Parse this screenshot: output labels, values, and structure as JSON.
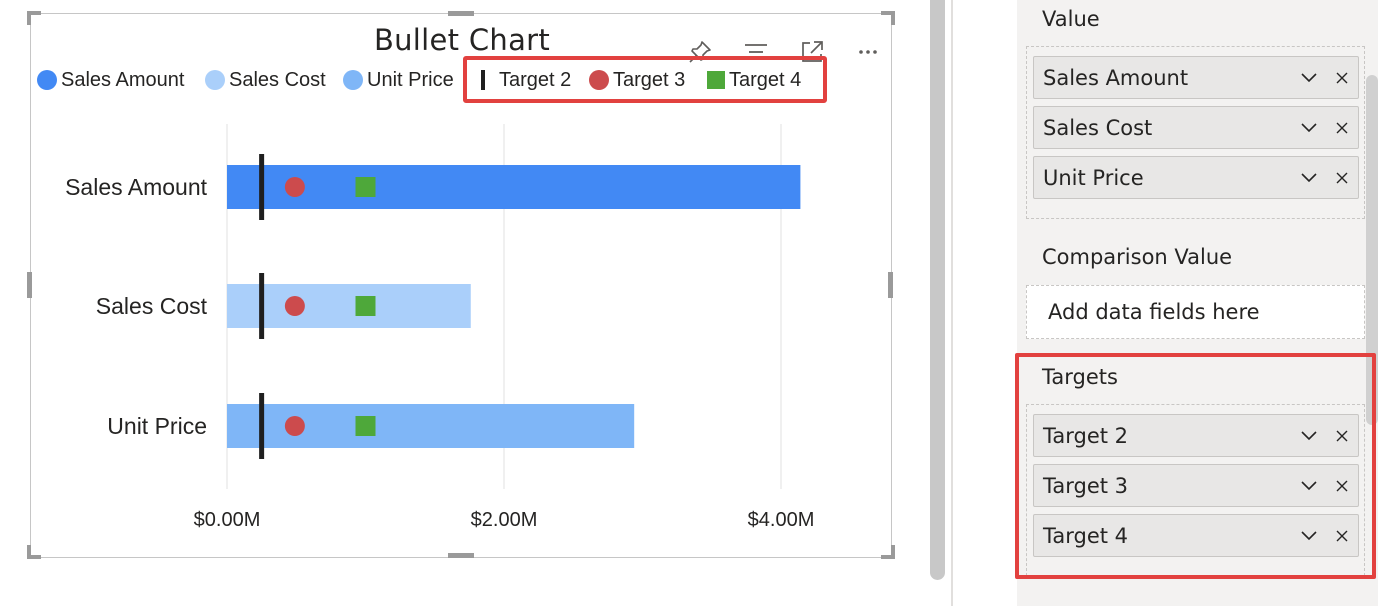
{
  "visual": {
    "title": "Bullet Chart",
    "header_icons": [
      "pin-icon",
      "filter-icon",
      "focus-mode-icon",
      "more-options-icon"
    ]
  },
  "legend": [
    {
      "label": "Sales Amount",
      "marker": "circle",
      "color": "#4289f4"
    },
    {
      "label": "Sales Cost",
      "marker": "circle",
      "color": "#aacffa"
    },
    {
      "label": "Unit Price",
      "marker": "circle",
      "color": "#7fb6f7"
    },
    {
      "label": "Target 2",
      "marker": "line",
      "color": "#1f1f1f"
    },
    {
      "label": "Target 3",
      "marker": "circle",
      "color": "#cc4b4d"
    },
    {
      "label": "Target 4",
      "marker": "square",
      "color": "#4ea83a"
    }
  ],
  "chart_data": {
    "type": "bar",
    "orientation": "horizontal",
    "title": "Bullet Chart",
    "categories": [
      "Sales Amount",
      "Sales Cost",
      "Unit Price"
    ],
    "series": [
      {
        "name": "Sales Amount",
        "values": [
          4.14,
          null,
          null
        ],
        "color": "#4289f4"
      },
      {
        "name": "Sales Cost",
        "values": [
          null,
          1.76,
          null
        ],
        "color": "#aacffa"
      },
      {
        "name": "Unit Price",
        "values": [
          null,
          null,
          2.94
        ],
        "color": "#7fb6f7"
      }
    ],
    "targets": [
      {
        "name": "Target 2",
        "marker": "line",
        "color": "#1f1f1f",
        "values": [
          0.25,
          0.25,
          0.25
        ]
      },
      {
        "name": "Target 3",
        "marker": "circle",
        "color": "#cc4b4d",
        "values": [
          0.49,
          0.49,
          0.49
        ]
      },
      {
        "name": "Target 4",
        "marker": "square",
        "color": "#4ea83a",
        "values": [
          1.0,
          1.0,
          1.0
        ]
      }
    ],
    "x_ticks": [
      {
        "value": 0,
        "label": "$0.00M"
      },
      {
        "value": 2,
        "label": "$2.00M"
      },
      {
        "value": 4,
        "label": "$4.00M"
      }
    ],
    "xlim": [
      0,
      4.5
    ],
    "x_unit": "$M",
    "grid": true,
    "legend_position": "top"
  },
  "fields_pane": {
    "value_label": "Value",
    "value_fields": [
      "Sales Amount",
      "Sales Cost",
      "Unit Price"
    ],
    "comparison_label": "Comparison Value",
    "comparison_placeholder": "Add data fields here",
    "targets_label": "Targets",
    "target_fields": [
      "Target 2",
      "Target 3",
      "Target 4"
    ]
  },
  "colors": {
    "highlight": "#e2413f",
    "pane_background": "#f3f2f1"
  }
}
